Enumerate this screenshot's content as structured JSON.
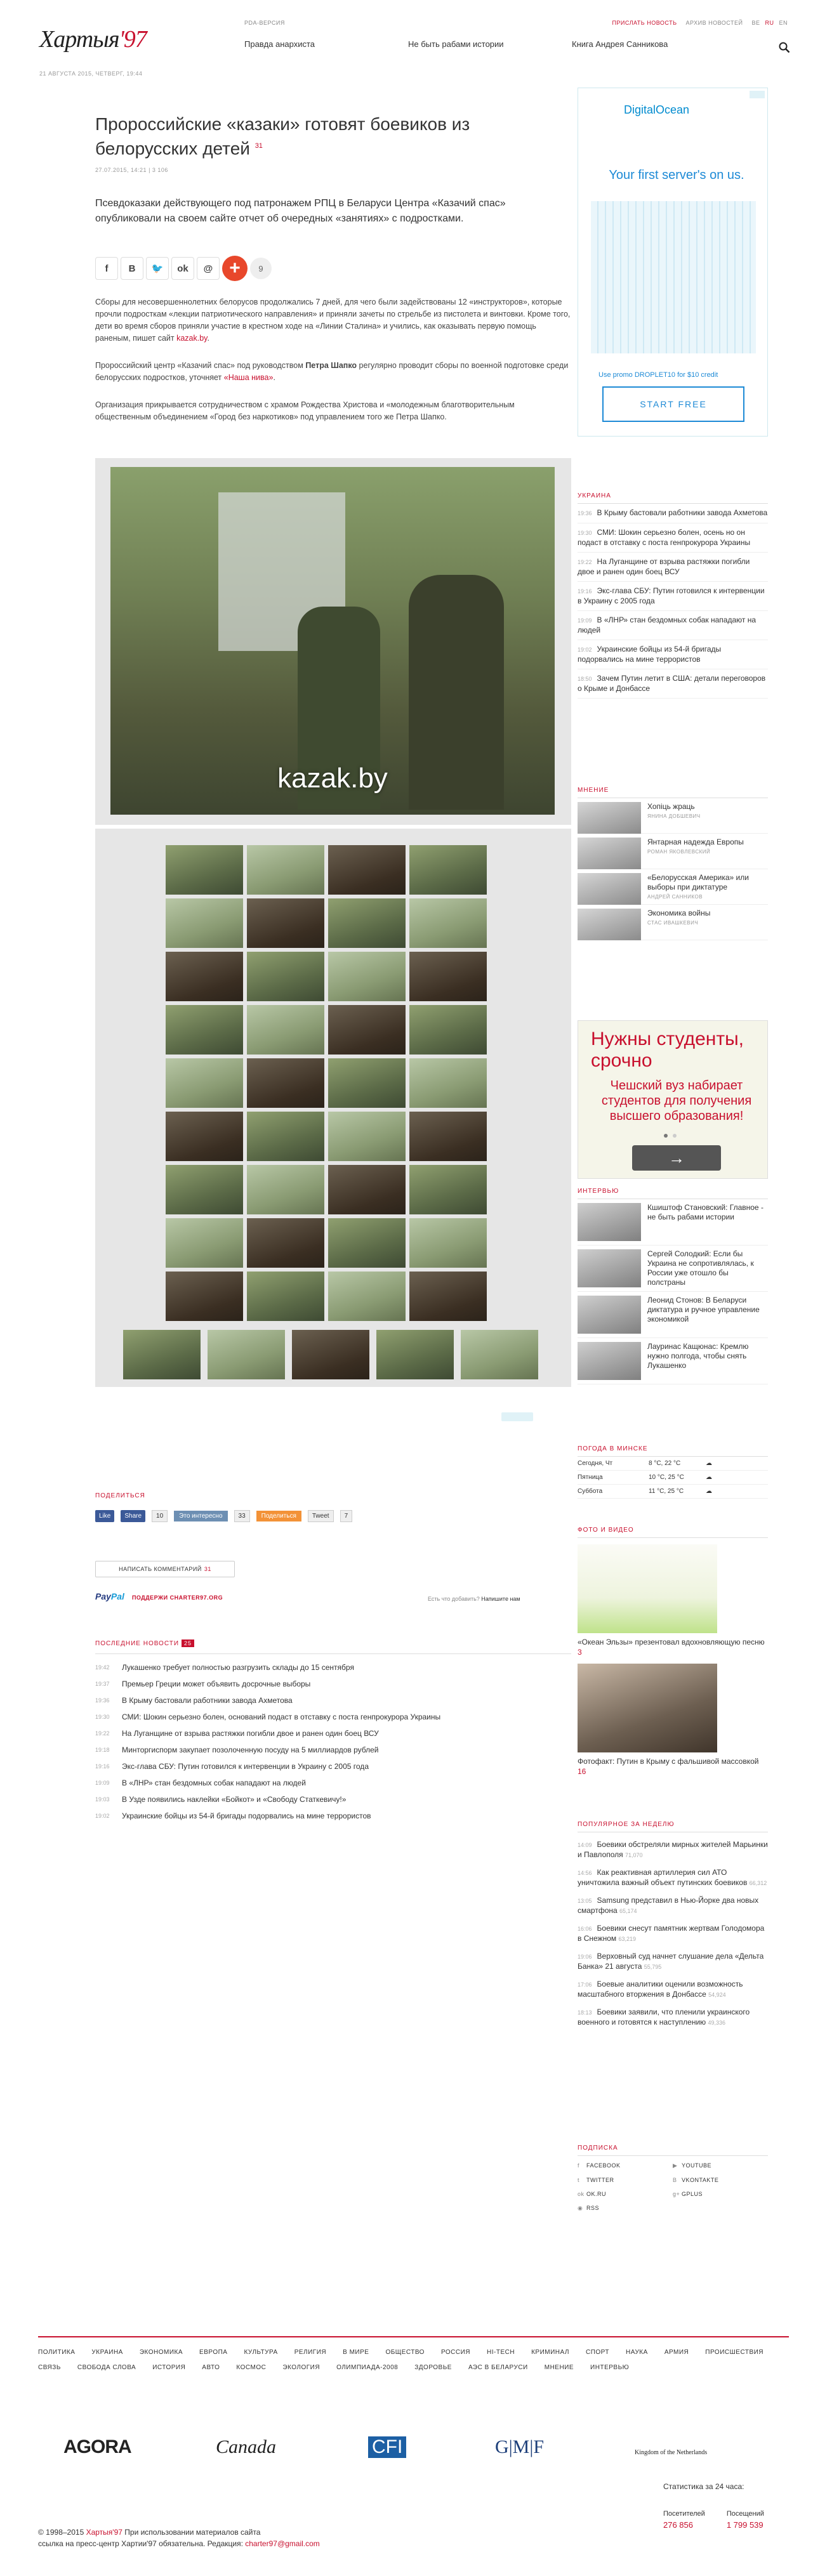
{
  "header": {
    "logo_main": "Хартыя",
    "logo_num": "'97",
    "date": "21 АВГУСТА 2015, ЧЕТВЕРГ, 19:44",
    "pda": "PDA-ВЕРСИЯ",
    "send_news": "ПРИСЛАТЬ НОВОСТЬ",
    "archive": "АРХИВ НОВОСТЕЙ",
    "languages": [
      "BE",
      "RU",
      "EN"
    ],
    "nav": [
      "Правда анархиста",
      "Не быть рабами истории",
      "Книга Андрея Санникова"
    ]
  },
  "article": {
    "title": "Пророссийские «казаки» готовят боевиков из белорусских детей",
    "title_count": "31",
    "meta": "27.07.2015, 14:21  |  3 106",
    "lead": "Псевдоказаки действующего под патронажем РПЦ в Беларуси Центра «Казачий спас» опубликовали на своем сайте отчет об очередных «занятиях» с подростками.",
    "share_count": "9",
    "p1": "Сборы для несовершеннолетних белорусов продолжались 7 дней, для чего были задействованы 12 «инструкторов», которые прочли подросткам «лекции патриотического направления» и приняли зачеты по стрельбе из пистолета и винтовки. Кроме того, дети во время сборов приняли участие в крестном ходе на «Линии Сталина» и учились, как оказывать первую помощь раненым, пишет сайт",
    "p1_link": "kazak.by",
    "p2a": "Пророссийский центр «Казачий спас» под руководством",
    "p2_name": "Петра Шапко",
    "p2b": "регулярно проводит сборы по военной подготовке среди белорусских подростков, уточняет",
    "p2_link": "«Наша нива»",
    "p3": "Организация прикрывается сотрудничеством с храмом Рождества Христова и «молодежным благотворительным общественным объединением «Город без наркотиков» под управлением того же Петра Шапко.",
    "photo_watermark": "kazak.by"
  },
  "share_block": {
    "label": "ПОДЕЛИТЬСЯ",
    "fb_like": "Like",
    "fb_share": "Share",
    "fb_count": "10",
    "interesting": "Это интересно",
    "interesting_count": "33",
    "podelitsa": "Поделиться",
    "tweet": "Tweet",
    "tweet_count": "7"
  },
  "comment_button": {
    "label": "НАПИСАТЬ КОММЕНТАРИЙ",
    "count": "31"
  },
  "paypal": {
    "pay": "Pay",
    "pal": "Pal",
    "support": "ПОДДЕРЖИ CHARTER97.ORG"
  },
  "error_tip": {
    "q": "Есть что добавить?",
    "a": "Напишите нам"
  },
  "latest": {
    "title": "ПОСЛЕДНИЕ НОВОСТИ",
    "count": "25",
    "items": [
      {
        "t": "19:42",
        "text": "Лукашенко требует полностью разгрузить склады до 15 сентября"
      },
      {
        "t": "19:37",
        "text": "Премьер Греции может объявить досрочные выборы"
      },
      {
        "t": "19:36",
        "text": "В Крыму бастовали работники завода Ахметова"
      },
      {
        "t": "19:30",
        "text": "СМИ: Шокин серьезно болен, оснований подаст в отставку с поста генпрокурора Украины"
      },
      {
        "t": "19:22",
        "text": "На Луганщине от взрыва растяжки погибли двое и ранен один боец ВСУ"
      },
      {
        "t": "19:18",
        "text": "Минторгиспорм закупает позолоченную посуду на 5 миллиардов рублей"
      },
      {
        "t": "19:16",
        "text": "Экс-глава СБУ: Путин готовился к интервенции в Украину с 2005 года"
      },
      {
        "t": "19:09",
        "text": "В «ЛНР» стан бездомных собак нападают на людей"
      },
      {
        "t": "19:03",
        "text": "В Узде появились наклейки «Бойкот» и «Свободу Статкевичу!»"
      },
      {
        "t": "19:02",
        "text": "Украинские бойцы из 54-й бригады подорвались на мине террористов"
      }
    ]
  },
  "sidebar": {
    "ad_do": {
      "brand": "DigitalOcean",
      "tag": "Your first server's on us.",
      "promo": "Use promo DROPLET10 for $10 credit",
      "cta": "START FREE"
    },
    "ukraine": {
      "title": "УКРАИНА",
      "items": [
        {
          "t": "19:36",
          "text": "В Крыму бастовали работники завода Ахметова"
        },
        {
          "t": "19:30",
          "text": "СМИ: Шокин серьезно болен, осень но он подаст в отставку с поста генпрокурора Украины"
        },
        {
          "t": "19:22",
          "text": "На Луганщине от взрыва растяжки погибли двое и ранен один боец ВСУ"
        },
        {
          "t": "19:16",
          "text": "Экс-глава СБУ: Путин готовился к интервенции в Украину с 2005 года"
        },
        {
          "t": "19:09",
          "text": "В «ЛНР» стан бездомных собак нападают на людей"
        },
        {
          "t": "19:02",
          "text": "Украинские бойцы из 54-й бригады подорвались на мине террористов"
        },
        {
          "t": "18:50",
          "text": "Зачем Путин летит в США: детали переговоров о Крыме и Донбассе"
        }
      ]
    },
    "opinions": {
      "title": "МНЕНИЕ",
      "items": [
        {
          "title": "Хопіць жраць",
          "author": "ЯНИНА ДОБШЕВИЧ"
        },
        {
          "title": "Янтарная надежда Европы",
          "author": "РОМАН ЯКОВЛЕВСКИЙ"
        },
        {
          "title": "«Белорусская Америка» или выборы при диктатуре",
          "author": "АНДРЕЙ САННИКОВ"
        },
        {
          "title": "Экономика войны",
          "author": "СТАС ИВАШКЕВИЧ"
        }
      ]
    },
    "ad_red": {
      "big": "Нужны студенты, срочно",
      "small": "Чешский вуз набирает студентов для получения высшего образования!",
      "btn": "→"
    },
    "interviews": {
      "title": "ИНТЕРВЬЮ",
      "items": [
        "Кшиштоф Становский: Главное - не быть рабами истории",
        "Сергей Солодкий: Если бы Украина не сопротивлялась, к России уже отошло бы полстраны",
        "Леонид Стонов: В Беларуси диктатура и ручное управление экономикой",
        "Лауринас Кащюнас: Кремлю нужно полгода, чтобы снять Лукашенко"
      ]
    },
    "weather": {
      "title": "ПОГОДА В МИНСКЕ",
      "rows": [
        {
          "day": "Сегодня, Чт",
          "temp": "8 °C, 22 °C",
          "icon": "☁"
        },
        {
          "day": "Пятница",
          "temp": "10 °C, 25 °C",
          "icon": "☁"
        },
        {
          "day": "Суббота",
          "temp": "11 °C, 25 °C",
          "icon": "☁"
        }
      ]
    },
    "photo_video": {
      "title": "ФОТО И ВИДЕО",
      "cap1": "«Океан Эльзы» презентовал вдохновляющую песню",
      "cap1_count": "3",
      "cap2": "Фотофакт: Путин в Крыму с фальшивой массовкой",
      "cap2_count": "16"
    },
    "popular": {
      "title": "ПОПУЛЯРНОЕ ЗА НЕДЕЛЮ",
      "items": [
        {
          "t": "14:09",
          "text": "Боевики обстреляли мирных жителей Марьинки и Павлополя",
          "v": "71,070"
        },
        {
          "t": "14:56",
          "text": "Как реактивная артиллерия сил АТО уничтожила важный объект путинских боевиков",
          "v": "66,312"
        },
        {
          "t": "13:05",
          "text": "Samsung представил в Нью-Йорке два новых смартфона",
          "v": "65,174"
        },
        {
          "t": "16:06",
          "text": "Боевики снесут памятник жертвам Голодомора в Снежном",
          "v": "63,219"
        },
        {
          "t": "19:06",
          "text": "Верховный суд начнет слушание дела «Дельта Банка» 21 августа",
          "v": "55,795"
        },
        {
          "t": "17:06",
          "text": "Боевые аналитики оценили возможность масштабного вторжения в Донбассе",
          "v": "54,924"
        },
        {
          "t": "18:13",
          "text": "Боевики заявили, что пленили украинского военного и готовятся к наступлению",
          "v": "49,336"
        }
      ]
    },
    "subscribe": {
      "title": "ПОДПИСКА",
      "items": [
        "FACEBOOK",
        "YOUTUBE",
        "TWITTER",
        "VKONTAKTE",
        "OK.RU",
        "GPLUS",
        "RSS"
      ]
    }
  },
  "footer": {
    "nav1": [
      "ПОЛИТИКА",
      "УКРАИНА",
      "ЭКОНОМИКА",
      "ЕВРОПА",
      "КУЛЬТУРА",
      "РЕЛИГИЯ",
      "В МИРЕ",
      "ОБЩЕСТВО",
      "РОССИЯ",
      "HI-TECH",
      "КРИМИНАЛ",
      "СПОРТ",
      "НАУКА",
      "АРМИЯ",
      "ПРОИСШЕСТВИЯ"
    ],
    "nav2": [
      "СВЯЗЬ",
      "СВОБОДА СЛОВА",
      "ИСТОРИЯ",
      "АВТО",
      "КОСМОС",
      "ЭКОЛОГИЯ",
      "ОЛИМПИАДА-2008",
      "ЗДОРОВЬЕ",
      "АЭС В БЕЛАРУСИ",
      "МНЕНИЕ",
      "ИНТЕРВЬЮ"
    ],
    "partners": [
      "AGORA",
      "Canada",
      "CFI",
      "G|M|F",
      "Kingdom of the Netherlands"
    ],
    "copy1a": "© 1998–2015 ",
    "copy1b": "Хартыя'97",
    "copy1c": " При использовании материалов сайта",
    "copy2": "ссылка на пресс-центр Хартии'97 обязательна. Редакция:",
    "email": "charter97@gmail.com",
    "stats_title": "Статистика за 24 часа:",
    "visitors_label": "Посетителей",
    "visitors": "276 856",
    "views_label": "Посещений",
    "views": "1 799 539"
  },
  "colors": {
    "accent": "#c8102e"
  }
}
